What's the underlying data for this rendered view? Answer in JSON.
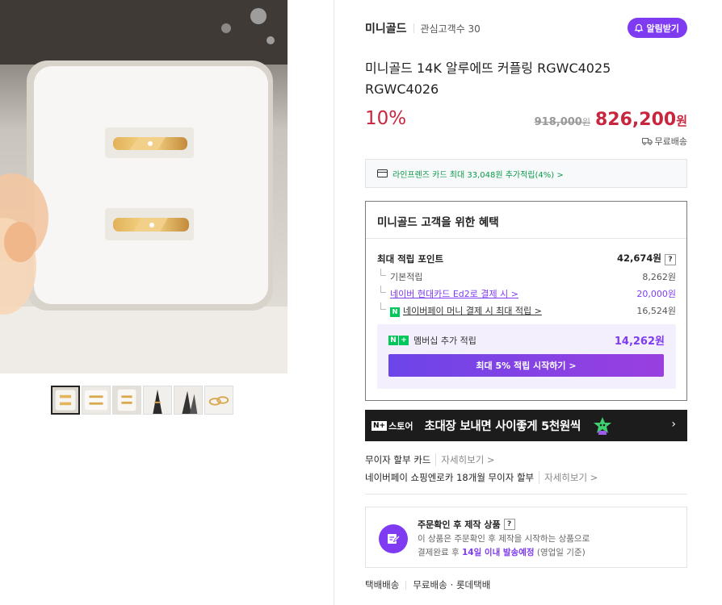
{
  "store": {
    "name": "미니골드",
    "fav_label": "관심고객수 30",
    "alarm_label": "알림받기"
  },
  "product": {
    "title": "미니골드 14K 알루에뜨 커플링 RGWC4025 RGWC4026",
    "discount": "10%",
    "original_price": "918,000",
    "original_unit": "원",
    "sale_price": "826,200",
    "sale_unit": "원",
    "shipping": "무료배송"
  },
  "card_promo": "라인프렌즈 카드 최대 33,048원 추가적립(4%) >",
  "benefit": {
    "title": "미니골드 고객을 위한 혜택",
    "max_points_label": "최대 적립 포인트",
    "max_points_value": "42,674원",
    "rows": [
      {
        "label": "기본적립",
        "value": "8,262원"
      },
      {
        "label": "네이버 현대카드 Ed2로 결제 시 >",
        "value": "20,000원"
      },
      {
        "label": "네이버페이 머니 결제 시 최대 적립 >",
        "value": "16,524원"
      }
    ],
    "membership_label": "멤버십 추가 적립",
    "membership_value": "14,262원",
    "start_button": "최대 5% 적립 시작하기 >"
  },
  "banner": {
    "brand": "스토어",
    "text": "초대장 보내면 사이좋게 5천원씩"
  },
  "installment": [
    {
      "label": "무이자 할부 카드",
      "more": "자세히보기 >"
    },
    {
      "label": "네이버페이 쇼핑엔로카 18개월 무이자 할부",
      "more": "자세히보기 >"
    }
  ],
  "made_to_order": {
    "title": "주문확인 후 제작 상품",
    "desc1": "이 상품은 주문확인 후 제작을 시작하는 상품으로",
    "desc2_prefix": "결제완료 후",
    "desc2_strong": "14일 이내 발송예정",
    "desc2_suffix": "(영업일 기준)"
  },
  "delivery": {
    "type": "택배배송",
    "fee": "무료배송",
    "carrier": "· 롯데택배"
  },
  "colors": {
    "accent": "#7e3bf1",
    "price": "#c8253e",
    "green": "#03c75a"
  }
}
